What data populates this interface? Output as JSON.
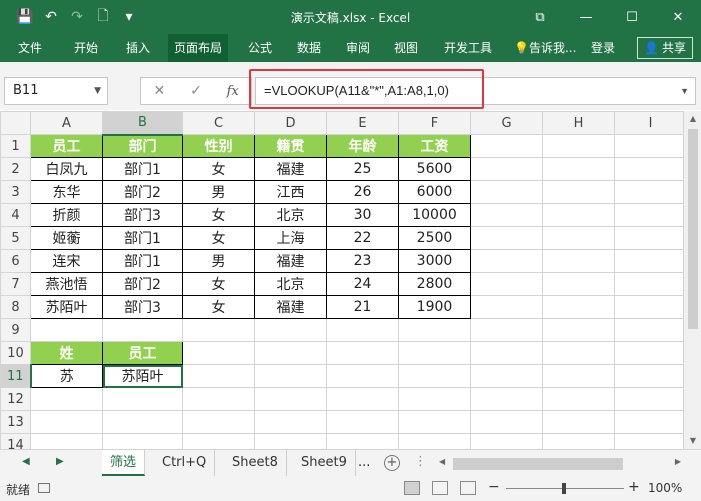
{
  "window": {
    "title": "演示文稿.xlsx - Excel",
    "qat": {
      "save": "💾",
      "undo": "↶",
      "redo": "↷",
      "new": "🗋",
      "customize": "▾"
    },
    "controls": {
      "ribbon_display": "⧉",
      "minimize": "—",
      "maximize": "☐",
      "close": "✕"
    }
  },
  "ribbon": {
    "tabs": [
      "文件",
      "开始",
      "插入",
      "页面布局",
      "公式",
      "数据",
      "审阅",
      "视图",
      "开发工具"
    ],
    "active_tab": "页面布局",
    "tellme": "告诉我...",
    "login": "登录",
    "share": "共享",
    "accent": "#217346"
  },
  "formula_bar": {
    "name_box": "B11",
    "formula": "=VLOOKUP(A11&\"*\",A1:A8,1,0)",
    "cancel": "✕",
    "enter": "✓",
    "fx": "fx"
  },
  "grid": {
    "columns": [
      "A",
      "B",
      "C",
      "D",
      "E",
      "F",
      "G",
      "H",
      "I"
    ],
    "rows": [
      "1",
      "2",
      "3",
      "4",
      "5",
      "6",
      "7",
      "8",
      "9",
      "10",
      "11",
      "12",
      "13",
      "14"
    ],
    "header_fill": "#92d050",
    "table1": {
      "headers": [
        "员工",
        "部门",
        "性别",
        "籍贯",
        "年龄",
        "工资"
      ],
      "rows": [
        [
          "白凤九",
          "部门1",
          "女",
          "福建",
          "25",
          "5600"
        ],
        [
          "东华",
          "部门2",
          "男",
          "江西",
          "26",
          "6000"
        ],
        [
          "折颜",
          "部门3",
          "女",
          "北京",
          "30",
          "10000"
        ],
        [
          "姬蘅",
          "部门1",
          "女",
          "上海",
          "22",
          "2500"
        ],
        [
          "连宋",
          "部门1",
          "男",
          "福建",
          "23",
          "3000"
        ],
        [
          "燕池悟",
          "部门2",
          "女",
          "北京",
          "24",
          "2800"
        ],
        [
          "苏陌叶",
          "部门3",
          "女",
          "福建",
          "21",
          "1900"
        ]
      ]
    },
    "table2": {
      "headers": [
        "姓",
        "员工"
      ],
      "row": [
        "苏",
        "苏陌叶"
      ]
    }
  },
  "sheets": {
    "tabs": [
      "筛选",
      "Ctrl+Q",
      "Sheet8",
      "Sheet9"
    ],
    "active": "筛选",
    "more": "...",
    "add": "+"
  },
  "status": {
    "ready": "就绪",
    "zoom": "100%",
    "zoom_minus": "−",
    "zoom_plus": "+"
  }
}
